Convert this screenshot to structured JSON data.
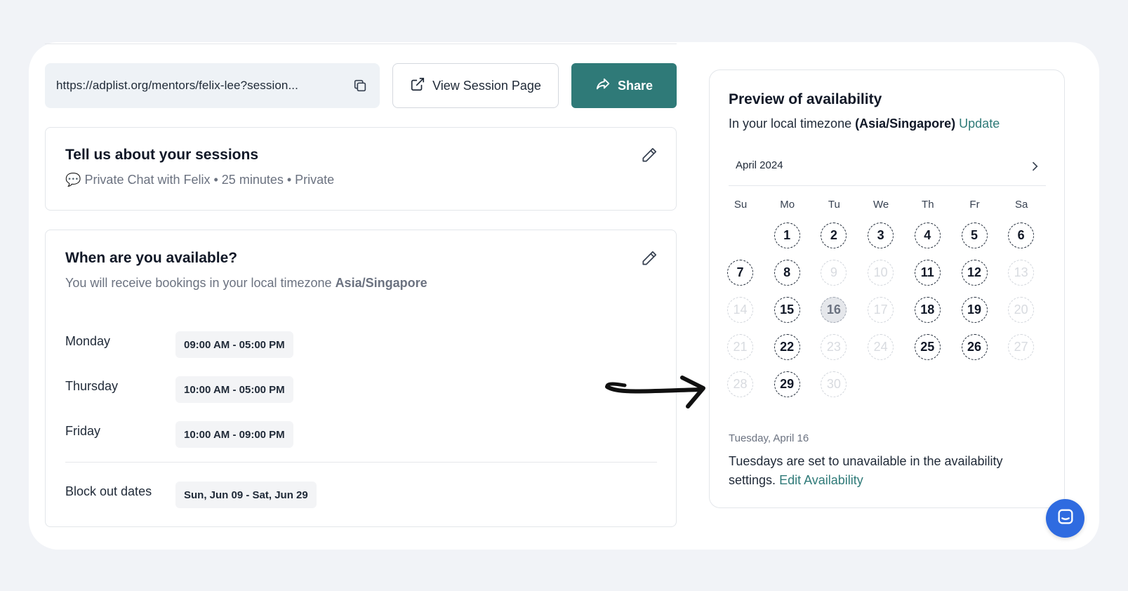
{
  "share": {
    "url": "https://adplist.org/mentors/felix-lee?session...",
    "view_label": "View Session Page",
    "share_label": "Share"
  },
  "sessions": {
    "title": "Tell us about your sessions",
    "subtitle": "Private Chat with Felix • 25 minutes • Private"
  },
  "availability": {
    "title": "When are you available?",
    "subtitle_prefix": "You will receive bookings in your local timezone",
    "timezone": "Asia/Singapore",
    "schedule": [
      {
        "day": "Monday",
        "time": "09:00 AM - 05:00 PM"
      },
      {
        "day": "Thursday",
        "time": "10:00 AM - 05:00 PM"
      },
      {
        "day": "Friday",
        "time": "10:00 AM - 09:00 PM"
      }
    ],
    "blockout_label": "Block out dates",
    "blockout_value": "Sun, Jun 09 - Sat, Jun 29"
  },
  "preview": {
    "title": "Preview of availability",
    "tz_prefix": "In your local timezone",
    "tz_value": "(Asia/Singapore)",
    "update_label": "Update",
    "month": "April 2024",
    "weekdays": [
      "Su",
      "Mo",
      "Tu",
      "We",
      "Th",
      "Fr",
      "Sa"
    ],
    "available_days": [
      1,
      2,
      3,
      4,
      5,
      6,
      7,
      8,
      11,
      12,
      15,
      18,
      19,
      22,
      25,
      26,
      29
    ],
    "unavailable_days": [
      9,
      10,
      13,
      14,
      17,
      20,
      21,
      23,
      24,
      27,
      28,
      30
    ],
    "selected_day": 16,
    "first_weekday": 1,
    "days_in_month": 30,
    "selected_date_label": "Tuesday, April 16",
    "note": "Tuesdays are set to unavailable in the availability settings.",
    "edit_link": "Edit Availability"
  },
  "colors": {
    "accent": "#2f7a78",
    "chat": "#2f6be0"
  }
}
